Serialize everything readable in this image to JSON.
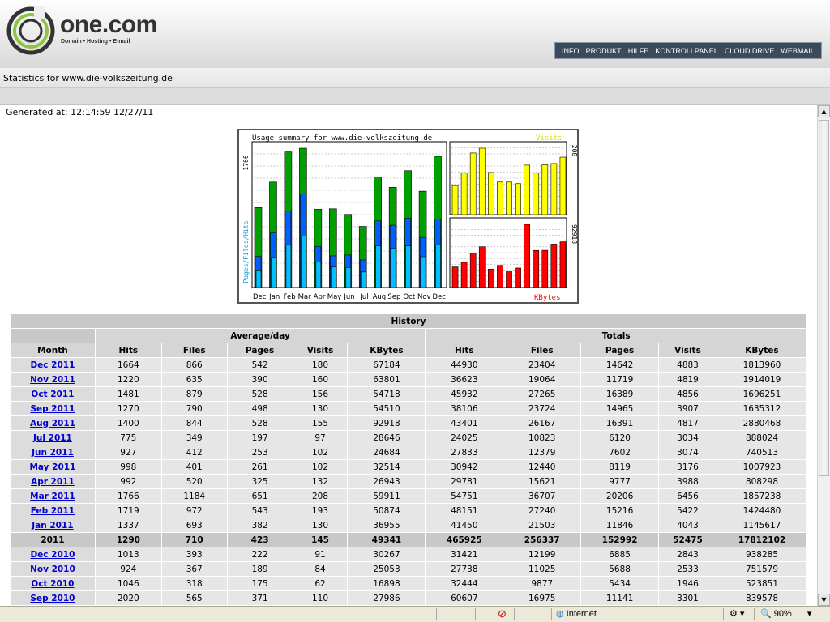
{
  "header": {
    "logo_text": "one.com",
    "logo_tagline": "Domain • Hosting • E-mail",
    "nav": [
      "INFO",
      "PRODUKT",
      "HILFE",
      "KONTROLLPANEL",
      "CLOUD DRIVE",
      "WEBMAIL"
    ],
    "stats_title": "Statistics for www.die-volkszeitung.de"
  },
  "generated": "Generated at: 12:14:59 12/27/11",
  "colors": {
    "hits": "#00a000",
    "files": "#0060ff",
    "pages": "#00c0ff",
    "visits": "#ffff00",
    "kbytes": "#ff0000"
  },
  "chart_data": {
    "type": "bar",
    "title": "Usage summary for www.die-volkszeitung.de",
    "categories": [
      "Dec",
      "Jan",
      "Feb",
      "Mar",
      "Apr",
      "May",
      "Jun",
      "Jul",
      "Aug",
      "Sep",
      "Oct",
      "Nov",
      "Dec"
    ],
    "left_panel": {
      "ylabel": "Pages/Files/Hits",
      "max_label": "1766",
      "ymax": 1766,
      "series": [
        {
          "name": "Hits",
          "values": [
            1013,
            1337,
            1719,
            1766,
            992,
            998,
            927,
            775,
            1400,
            1270,
            1481,
            1220,
            1664
          ]
        },
        {
          "name": "Files",
          "values": [
            393,
            693,
            972,
            1184,
            520,
            401,
            412,
            349,
            844,
            790,
            879,
            635,
            866
          ]
        },
        {
          "name": "Pages",
          "values": [
            222,
            382,
            543,
            651,
            325,
            261,
            253,
            197,
            528,
            498,
            528,
            390,
            542
          ]
        }
      ]
    },
    "visits_panel": {
      "label": "Visits",
      "max_label": "208",
      "ymax": 208,
      "values": [
        91,
        130,
        193,
        208,
        132,
        102,
        102,
        97,
        155,
        130,
        156,
        160,
        180
      ]
    },
    "kbytes_panel": {
      "label": "KBytes",
      "max_label": "92918",
      "ymax": 92918,
      "values": [
        30267,
        36955,
        50874,
        59911,
        26943,
        32514,
        24684,
        28646,
        92918,
        54510,
        54718,
        63801,
        67184
      ]
    }
  },
  "table": {
    "caption": "History",
    "group_average": "Average/day",
    "group_totals": "Totals",
    "columns": [
      "Month",
      "Hits",
      "Files",
      "Pages",
      "Visits",
      "KBytes",
      "Hits",
      "Files",
      "Pages",
      "Visits",
      "KBytes"
    ],
    "rows": [
      {
        "type": "month",
        "cells": [
          "Dec 2011",
          "1664",
          "866",
          "542",
          "180",
          "67184",
          "44930",
          "23404",
          "14642",
          "4883",
          "1813960"
        ]
      },
      {
        "type": "month",
        "cells": [
          "Nov 2011",
          "1220",
          "635",
          "390",
          "160",
          "63801",
          "36623",
          "19064",
          "11719",
          "4819",
          "1914019"
        ]
      },
      {
        "type": "month",
        "cells": [
          "Oct 2011",
          "1481",
          "879",
          "528",
          "156",
          "54718",
          "45932",
          "27265",
          "16389",
          "4856",
          "1696251"
        ]
      },
      {
        "type": "month",
        "cells": [
          "Sep 2011",
          "1270",
          "790",
          "498",
          "130",
          "54510",
          "38106",
          "23724",
          "14965",
          "3907",
          "1635312"
        ]
      },
      {
        "type": "month",
        "cells": [
          "Aug 2011",
          "1400",
          "844",
          "528",
          "155",
          "92918",
          "43401",
          "26167",
          "16391",
          "4817",
          "2880468"
        ]
      },
      {
        "type": "month",
        "cells": [
          "Jul 2011",
          "775",
          "349",
          "197",
          "97",
          "28646",
          "24025",
          "10823",
          "6120",
          "3034",
          "888024"
        ]
      },
      {
        "type": "month",
        "cells": [
          "Jun 2011",
          "927",
          "412",
          "253",
          "102",
          "24684",
          "27833",
          "12379",
          "7602",
          "3074",
          "740513"
        ]
      },
      {
        "type": "month",
        "cells": [
          "May 2011",
          "998",
          "401",
          "261",
          "102",
          "32514",
          "30942",
          "12440",
          "8119",
          "3176",
          "1007923"
        ]
      },
      {
        "type": "month",
        "cells": [
          "Apr 2011",
          "992",
          "520",
          "325",
          "132",
          "26943",
          "29781",
          "15621",
          "9777",
          "3988",
          "808298"
        ]
      },
      {
        "type": "month",
        "cells": [
          "Mar 2011",
          "1766",
          "1184",
          "651",
          "208",
          "59911",
          "54751",
          "36707",
          "20206",
          "6456",
          "1857238"
        ]
      },
      {
        "type": "month",
        "cells": [
          "Feb 2011",
          "1719",
          "972",
          "543",
          "193",
          "50874",
          "48151",
          "27240",
          "15216",
          "5422",
          "1424480"
        ]
      },
      {
        "type": "month",
        "cells": [
          "Jan 2011",
          "1337",
          "693",
          "382",
          "130",
          "36955",
          "41450",
          "21503",
          "11846",
          "4043",
          "1145617"
        ]
      },
      {
        "type": "year",
        "cells": [
          "2011",
          "1290",
          "710",
          "423",
          "145",
          "49341",
          "465925",
          "256337",
          "152992",
          "52475",
          "17812102"
        ]
      },
      {
        "type": "month",
        "cells": [
          "Dec 2010",
          "1013",
          "393",
          "222",
          "91",
          "30267",
          "31421",
          "12199",
          "6885",
          "2843",
          "938285"
        ]
      },
      {
        "type": "month",
        "cells": [
          "Nov 2010",
          "924",
          "367",
          "189",
          "84",
          "25053",
          "27738",
          "11025",
          "5688",
          "2533",
          "751579"
        ]
      },
      {
        "type": "month",
        "cells": [
          "Oct 2010",
          "1046",
          "318",
          "175",
          "62",
          "16898",
          "32444",
          "9877",
          "5434",
          "1946",
          "523851"
        ]
      },
      {
        "type": "month",
        "cells": [
          "Sep 2010",
          "2020",
          "565",
          "371",
          "110",
          "27986",
          "60607",
          "16975",
          "11141",
          "3301",
          "839578"
        ]
      }
    ]
  },
  "statusbar": {
    "zone": "Internet",
    "zoom": "90%"
  }
}
